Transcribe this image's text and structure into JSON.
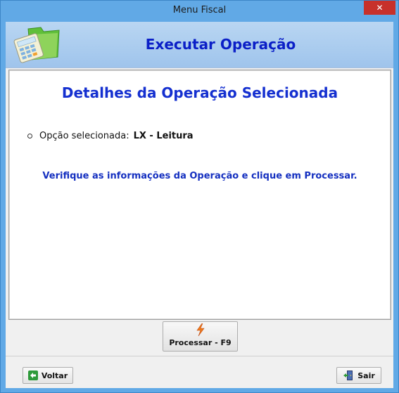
{
  "window": {
    "title": "Menu Fiscal",
    "close_glyph": "✕"
  },
  "header": {
    "icon": "calculator-folder-icon",
    "title": "Executar Operação"
  },
  "panel": {
    "title": "Detalhes da Operação Selecionada",
    "option_label": "Opção selecionada:",
    "option_value": "LX - Leitura",
    "message": "Verifique as informações da Operação e clique em Processar."
  },
  "actions": {
    "process_label": "Processar - F9",
    "process_icon": "lightning-icon",
    "back_label": "Voltar",
    "back_icon": "arrow-left-icon",
    "exit_label": "Sair",
    "exit_icon": "exit-door-icon"
  },
  "colors": {
    "title_blue": "#0b1fc7",
    "window_frame": "#61a9e6",
    "close_red": "#c7312b"
  }
}
